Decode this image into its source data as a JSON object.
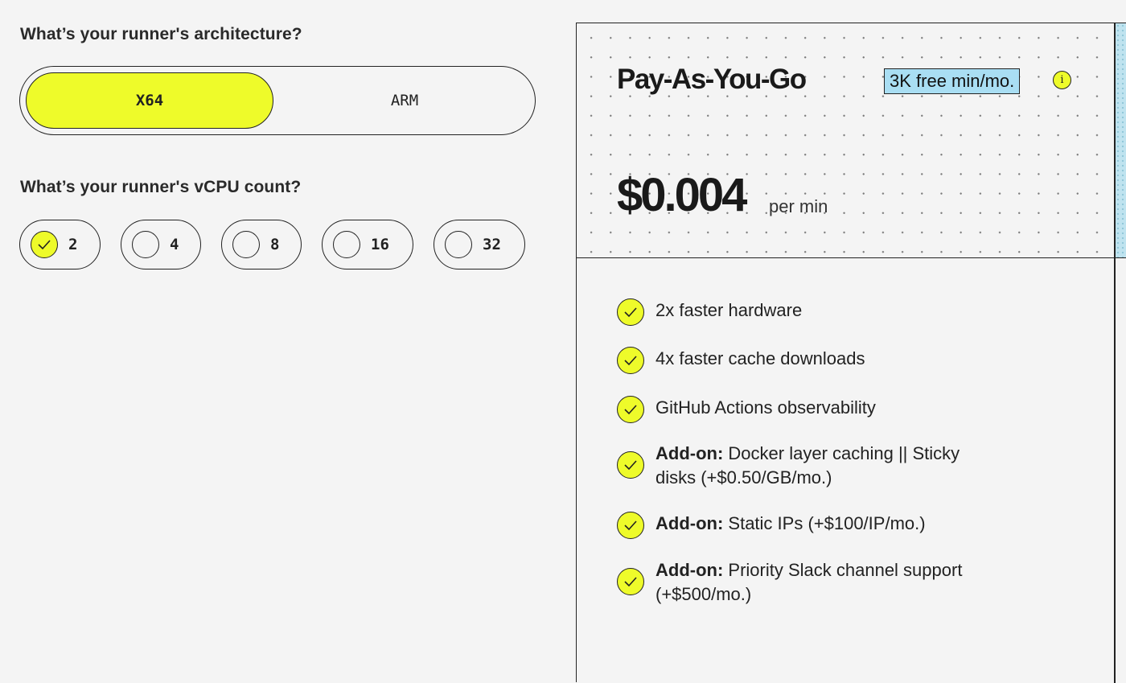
{
  "architecture": {
    "question": "What’s your runner's architecture?",
    "options": [
      {
        "label": "X64",
        "selected": true
      },
      {
        "label": "ARM",
        "selected": false
      }
    ]
  },
  "vcpu": {
    "question": "What’s your runner's vCPU count?",
    "options": [
      {
        "label": "2",
        "selected": true
      },
      {
        "label": "4",
        "selected": false
      },
      {
        "label": "8",
        "selected": false
      },
      {
        "label": "16",
        "selected": false
      },
      {
        "label": "32",
        "selected": false
      }
    ]
  },
  "plan": {
    "title": "Pay-As-You-Go",
    "badge": "3K free min/mo.",
    "info_icon": "i",
    "price": "$0.004",
    "price_unit": "per min",
    "features": [
      {
        "bold": "",
        "text": "2x faster hardware"
      },
      {
        "bold": "",
        "text": "4x faster cache downloads"
      },
      {
        "bold": "",
        "text": "GitHub Actions observability"
      },
      {
        "bold": "Add-on:",
        "text": " Docker layer caching || Sticky disks (+$0.50/GB/mo.)"
      },
      {
        "bold": "Add-on:",
        "text": " Static IPs (+$100/IP/mo.)"
      },
      {
        "bold": "Add-on:",
        "text": " Priority Slack channel support (+$500/mo.)"
      }
    ]
  },
  "colors": {
    "accent_yellow": "#eefb2a",
    "badge_blue": "#a9def3",
    "background": "#f4f4f4"
  }
}
